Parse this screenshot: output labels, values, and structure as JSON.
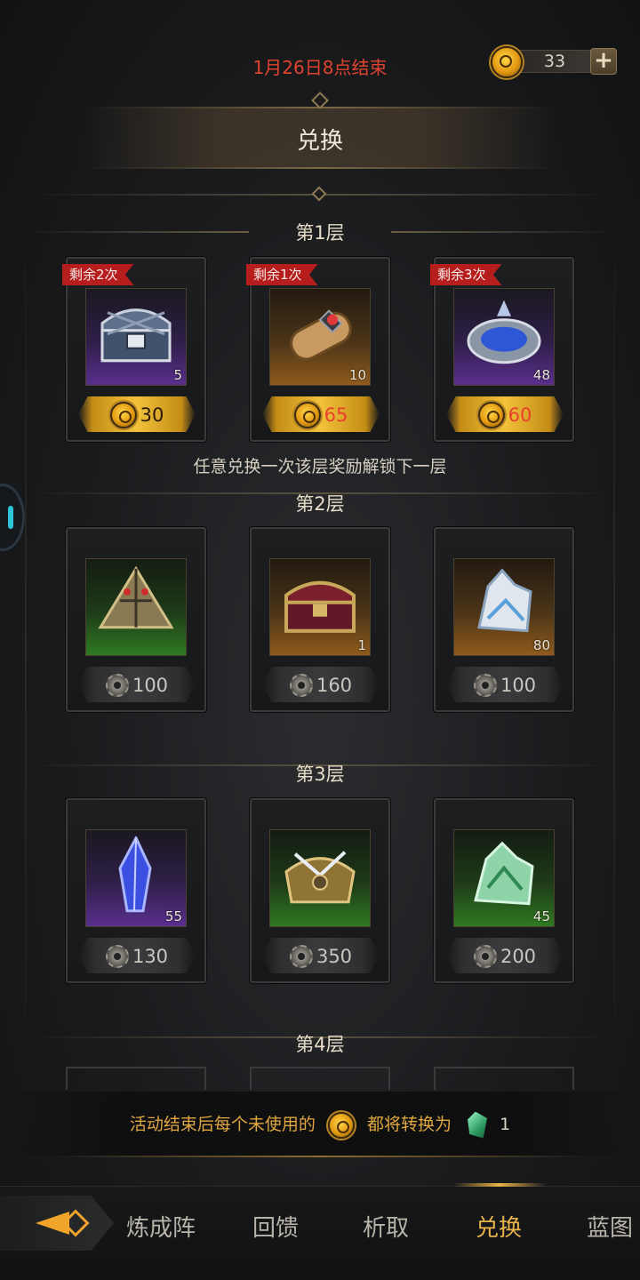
{
  "header": {
    "deadline": "1月26日8点结束",
    "currency_amount": "33",
    "title": "兑换"
  },
  "tiers": [
    {
      "label": "第1层",
      "items": [
        {
          "remaining": "剩余2次",
          "qty": "5",
          "price": "30",
          "price_color": "dark",
          "bg": "purple",
          "icon": "silver-chest-icon"
        },
        {
          "remaining": "剩余1次",
          "qty": "10",
          "price": "65",
          "price_color": "red",
          "bg": "orange",
          "icon": "scroll-icon"
        },
        {
          "remaining": "剩余3次",
          "qty": "48",
          "price": "60",
          "price_color": "red",
          "bg": "purple",
          "icon": "blue-ore-chest-icon"
        }
      ],
      "hint": "任意兑换一次该层奖励解锁下一层"
    },
    {
      "label": "第2层",
      "items": [
        {
          "qty": "",
          "price": "100",
          "bg": "green",
          "icon": "pyramid-gem-icon"
        },
        {
          "qty": "1",
          "price": "160",
          "bg": "orange",
          "icon": "red-chest-icon"
        },
        {
          "qty": "80",
          "price": "100",
          "bg": "orange",
          "icon": "ice-crystal-icon"
        }
      ]
    },
    {
      "label": "第3层",
      "items": [
        {
          "qty": "55",
          "price": "130",
          "bg": "purple",
          "icon": "blue-crystal-icon"
        },
        {
          "qty": "",
          "price": "350",
          "bg": "green",
          "icon": "ornate-chest-icon"
        },
        {
          "qty": "45",
          "price": "200",
          "bg": "green",
          "icon": "green-crystal-icon"
        }
      ]
    },
    {
      "label": "第4层"
    }
  ],
  "footer_notice": {
    "text_before": "活动结束后每个未使用的",
    "text_after": "都将转换为",
    "count": "1"
  },
  "tabs": [
    {
      "label": "炼成阵"
    },
    {
      "label": "回馈"
    },
    {
      "label": "析取"
    },
    {
      "label": "兑换",
      "active": true
    },
    {
      "label": "蓝图"
    }
  ],
  "colors": {
    "accent_gold": "#e9b24a",
    "deadline_red": "#e0432f",
    "ribbon_red": "#b61d1d"
  }
}
